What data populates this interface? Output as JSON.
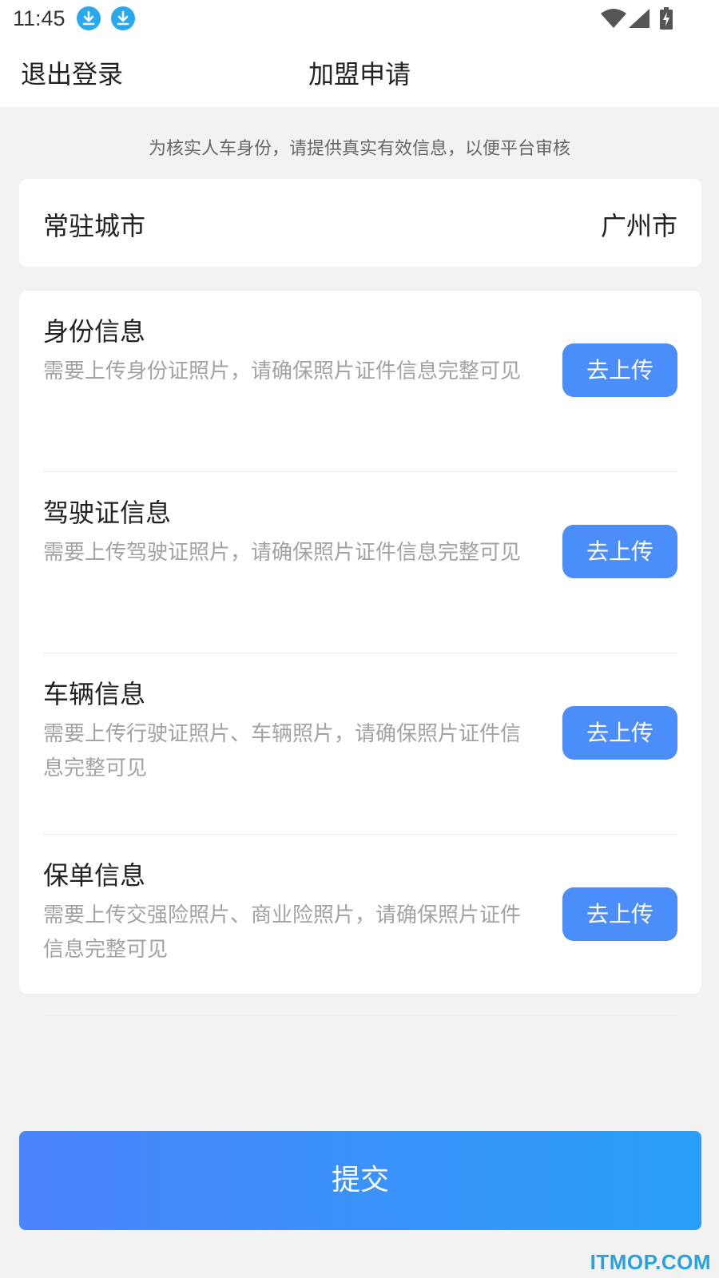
{
  "status_bar": {
    "time": "11:45",
    "icons": [
      "download-icon",
      "download-icon",
      "wifi-icon",
      "signal-icon",
      "battery-charging-icon"
    ]
  },
  "nav": {
    "logout_label": "退出登录",
    "title": "加盟申请"
  },
  "notice": "为核实人车身份，请提供真实有效信息，以便平台审核",
  "city": {
    "label": "常驻城市",
    "value": "广州市"
  },
  "documents": [
    {
      "title": "身份信息",
      "description": "需要上传身份证照片，请确保照片证件信息完整可见",
      "button_label": "去上传"
    },
    {
      "title": "驾驶证信息",
      "description": "需要上传驾驶证照片，请确保照片证件信息完整可见",
      "button_label": "去上传"
    },
    {
      "title": "车辆信息",
      "description": "需要上传行驶证照片、车辆照片，请确保照片证件信息完整可见",
      "button_label": "去上传"
    },
    {
      "title": "保单信息",
      "description": "需要上传交强险照片、商业险照片，请确保照片证件信息完整可见",
      "button_label": "去上传"
    }
  ],
  "submit_label": "提交",
  "watermark": "ITMOP.COM",
  "colors": {
    "accent": "#4b8dfa",
    "submit_gradient_start": "#4b84fb",
    "submit_gradient_end": "#2a9ff9",
    "background": "#f2f2f3",
    "watermark": "#2aa2df"
  }
}
